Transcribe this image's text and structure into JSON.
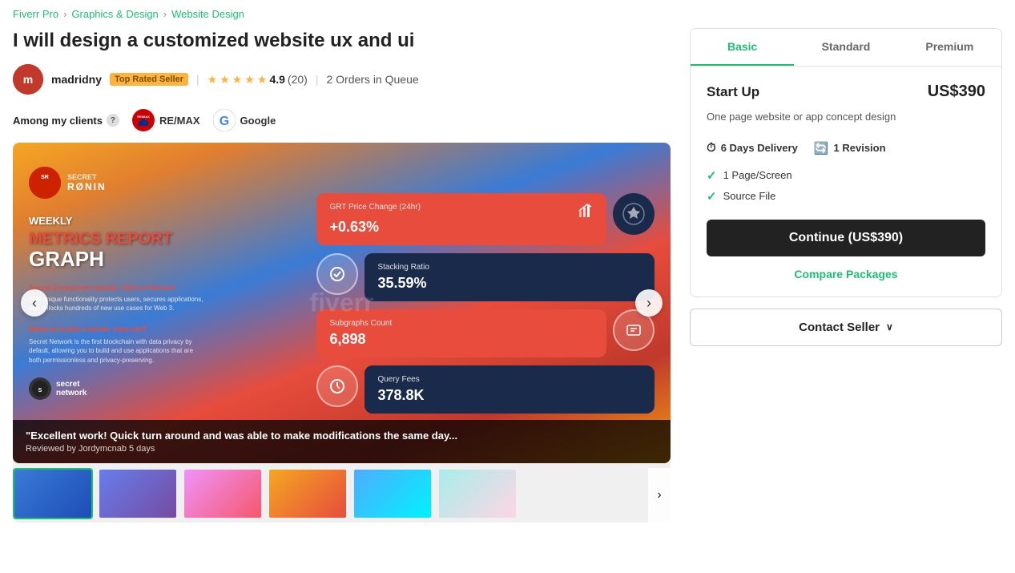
{
  "breadcrumb": {
    "items": [
      {
        "label": "Fiverr Pro",
        "link": true
      },
      {
        "label": "Graphics & Design",
        "link": true
      },
      {
        "label": "Website Design",
        "link": true,
        "current": true
      }
    ],
    "separators": [
      "›",
      "›"
    ]
  },
  "gig": {
    "title": "I will design a customized website ux and ui",
    "seller": {
      "name": "madridny",
      "badge": "Top Rated Seller",
      "rating": "4.9",
      "review_count": "(20)",
      "orders_queue": "2 Orders in Queue",
      "avatar_initials": "m"
    },
    "clients": {
      "label": "Among my clients",
      "logos": [
        {
          "name": "RE/MAX"
        },
        {
          "name": "Google"
        }
      ]
    },
    "carousel": {
      "main_image_alt": "Secret Ronin Weekly Metrics Report Graph",
      "overlay_brand": "SECRET RØNIN",
      "overlay_weekly": "WEEKLY",
      "overlay_title_line1": "METRICS REPORT",
      "overlay_title_line2": "GRAPH",
      "metrics": [
        {
          "label": "GRT Price Change (24hr)",
          "value": "+0.63%",
          "type": "red"
        },
        {
          "label": "Stacking Ratio",
          "value": "35.59%",
          "type": "dark"
        },
        {
          "label": "Subgraphs Count",
          "value": "6,898",
          "type": "red"
        },
        {
          "label": "Query Fees",
          "value": "378.8K",
          "type": "dark"
        }
      ],
      "review": {
        "text": "\"Excellent work! Quick turn around and was able to make modifications the same day...",
        "meta": "Reviewed by Jordymcnab 5 days"
      },
      "thumbnails": [
        {
          "id": 1,
          "active": true
        },
        {
          "id": 2,
          "active": false
        },
        {
          "id": 3,
          "active": false
        },
        {
          "id": 4,
          "active": false
        },
        {
          "id": 5,
          "active": false
        },
        {
          "id": 6,
          "active": false
        }
      ]
    }
  },
  "package_panel": {
    "tabs": [
      {
        "label": "Basic",
        "active": true
      },
      {
        "label": "Standard",
        "active": false
      },
      {
        "label": "Premium",
        "active": false
      }
    ],
    "active_package": {
      "name": "Start Up",
      "price": "US$390",
      "description": "One page website or app concept design",
      "delivery": "6 Days Delivery",
      "revisions": "1 Revision",
      "features": [
        "1 Page/Screen",
        "Source File"
      ],
      "cta_label": "Continue (US$390)",
      "compare_label": "Compare Packages",
      "contact_label": "Contact Seller"
    }
  }
}
